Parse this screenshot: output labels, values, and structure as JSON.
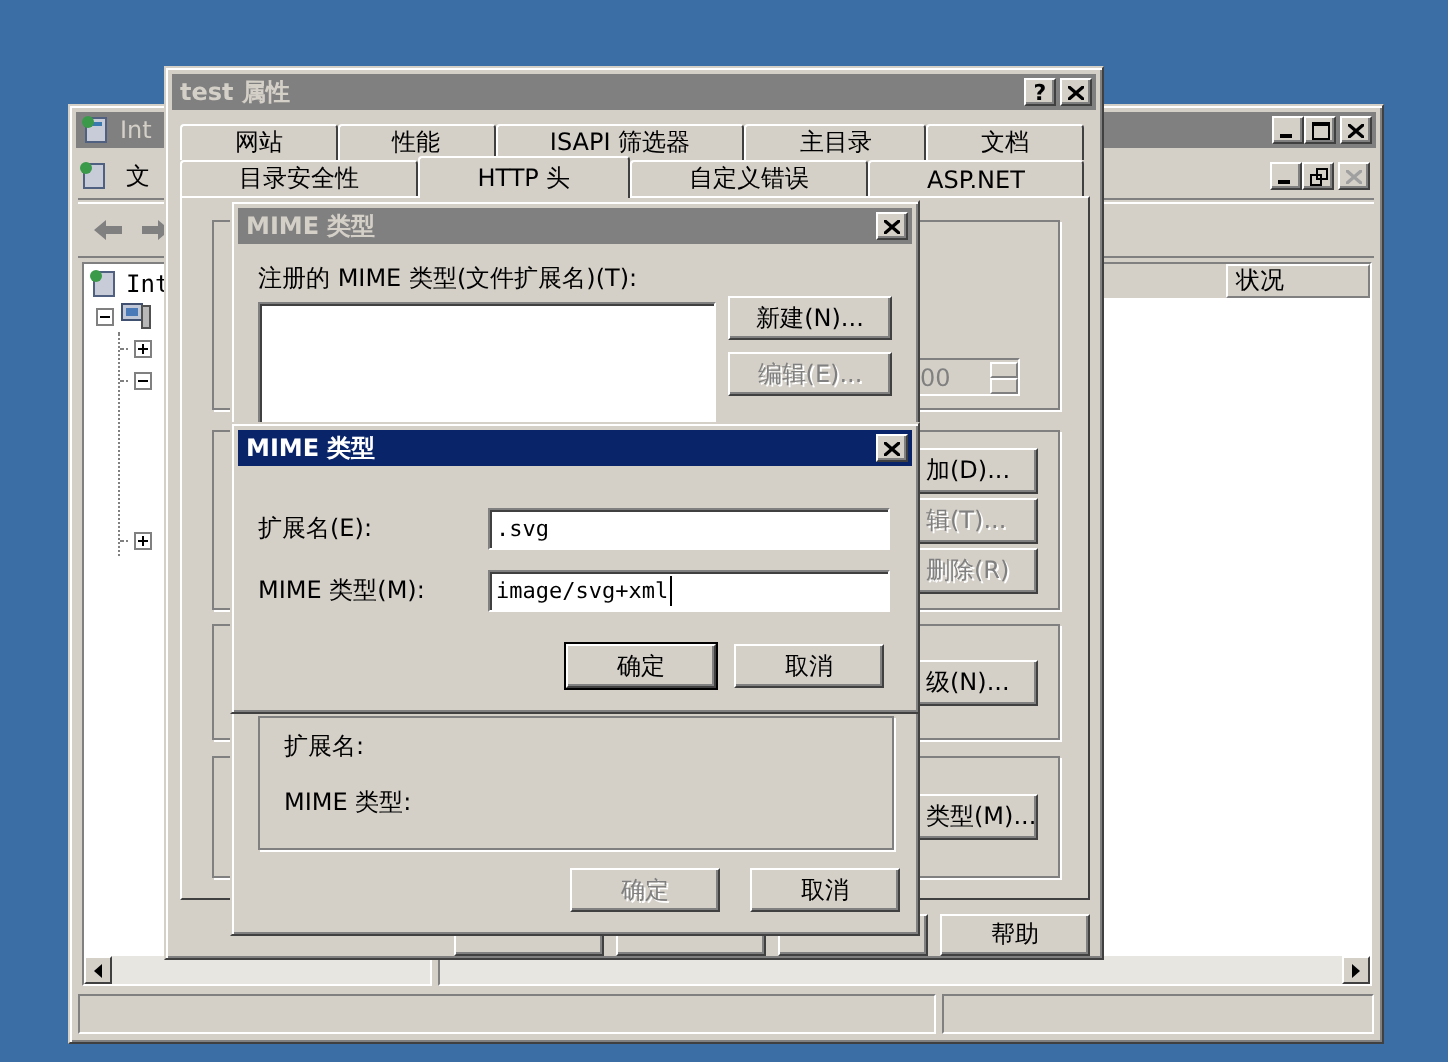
{
  "manager": {
    "title": "Int",
    "active": false,
    "menu_label": "文",
    "tree": [
      {
        "label": "Int",
        "children": [
          {
            "expanded": true,
            "children": [
              {
                "expanded": false
              },
              {
                "expanded": true
              },
              {
                "expanded": false
              }
            ]
          }
        ]
      }
    ],
    "columns": [
      "状况"
    ]
  },
  "properties": {
    "title": "test 属性",
    "active": false,
    "help_glyph": "?",
    "tab_rows": [
      [
        {
          "label": "网站",
          "selected": false
        },
        {
          "label": "性能",
          "selected": false
        },
        {
          "label": "ISAPI 筛选器",
          "selected": false
        },
        {
          "label": "主目录",
          "selected": false
        },
        {
          "label": "文档",
          "selected": false
        }
      ],
      [
        {
          "label": "目录安全性",
          "selected": false
        },
        {
          "label": "HTTP 头",
          "selected": true
        },
        {
          "label": "自定义错误",
          "selected": false
        },
        {
          "label": "ASP.NET",
          "selected": false
        }
      ]
    ],
    "spin": {
      "value": "00",
      "disabled": true
    },
    "side_buttons": [
      {
        "label": "加(D)...",
        "disabled": false
      },
      {
        "label": "辑(T)...",
        "disabled": true
      },
      {
        "label": "删除(R)",
        "disabled": true
      },
      {
        "label": "级(N)...",
        "disabled": false
      },
      {
        "label": "类型(M)...",
        "disabled": false
      }
    ],
    "help_button": "帮助"
  },
  "list_dialog": {
    "title": "MIME 类型",
    "active": false,
    "list_label": "注册的 MIME 类型(文件扩展名)(T):",
    "buttons": [
      {
        "label": "新建(N)...",
        "disabled": false
      },
      {
        "label": "编辑(E)...",
        "disabled": true
      }
    ],
    "details": [
      "扩展名:",
      "MIME 类型:"
    ],
    "ok": {
      "label": "确定",
      "disabled": true
    },
    "cancel": {
      "label": "取消",
      "disabled": false
    }
  },
  "edit_dialog": {
    "title": "MIME 类型",
    "active": true,
    "fields": [
      {
        "label": "扩展名(E):",
        "value": ".svg",
        "focused": false
      },
      {
        "label": "MIME 类型(M):",
        "value": "image/svg+xml",
        "focused": true
      }
    ],
    "buttons": [
      {
        "label": "确定",
        "default": true
      },
      {
        "label": "取消",
        "default": false
      }
    ]
  }
}
